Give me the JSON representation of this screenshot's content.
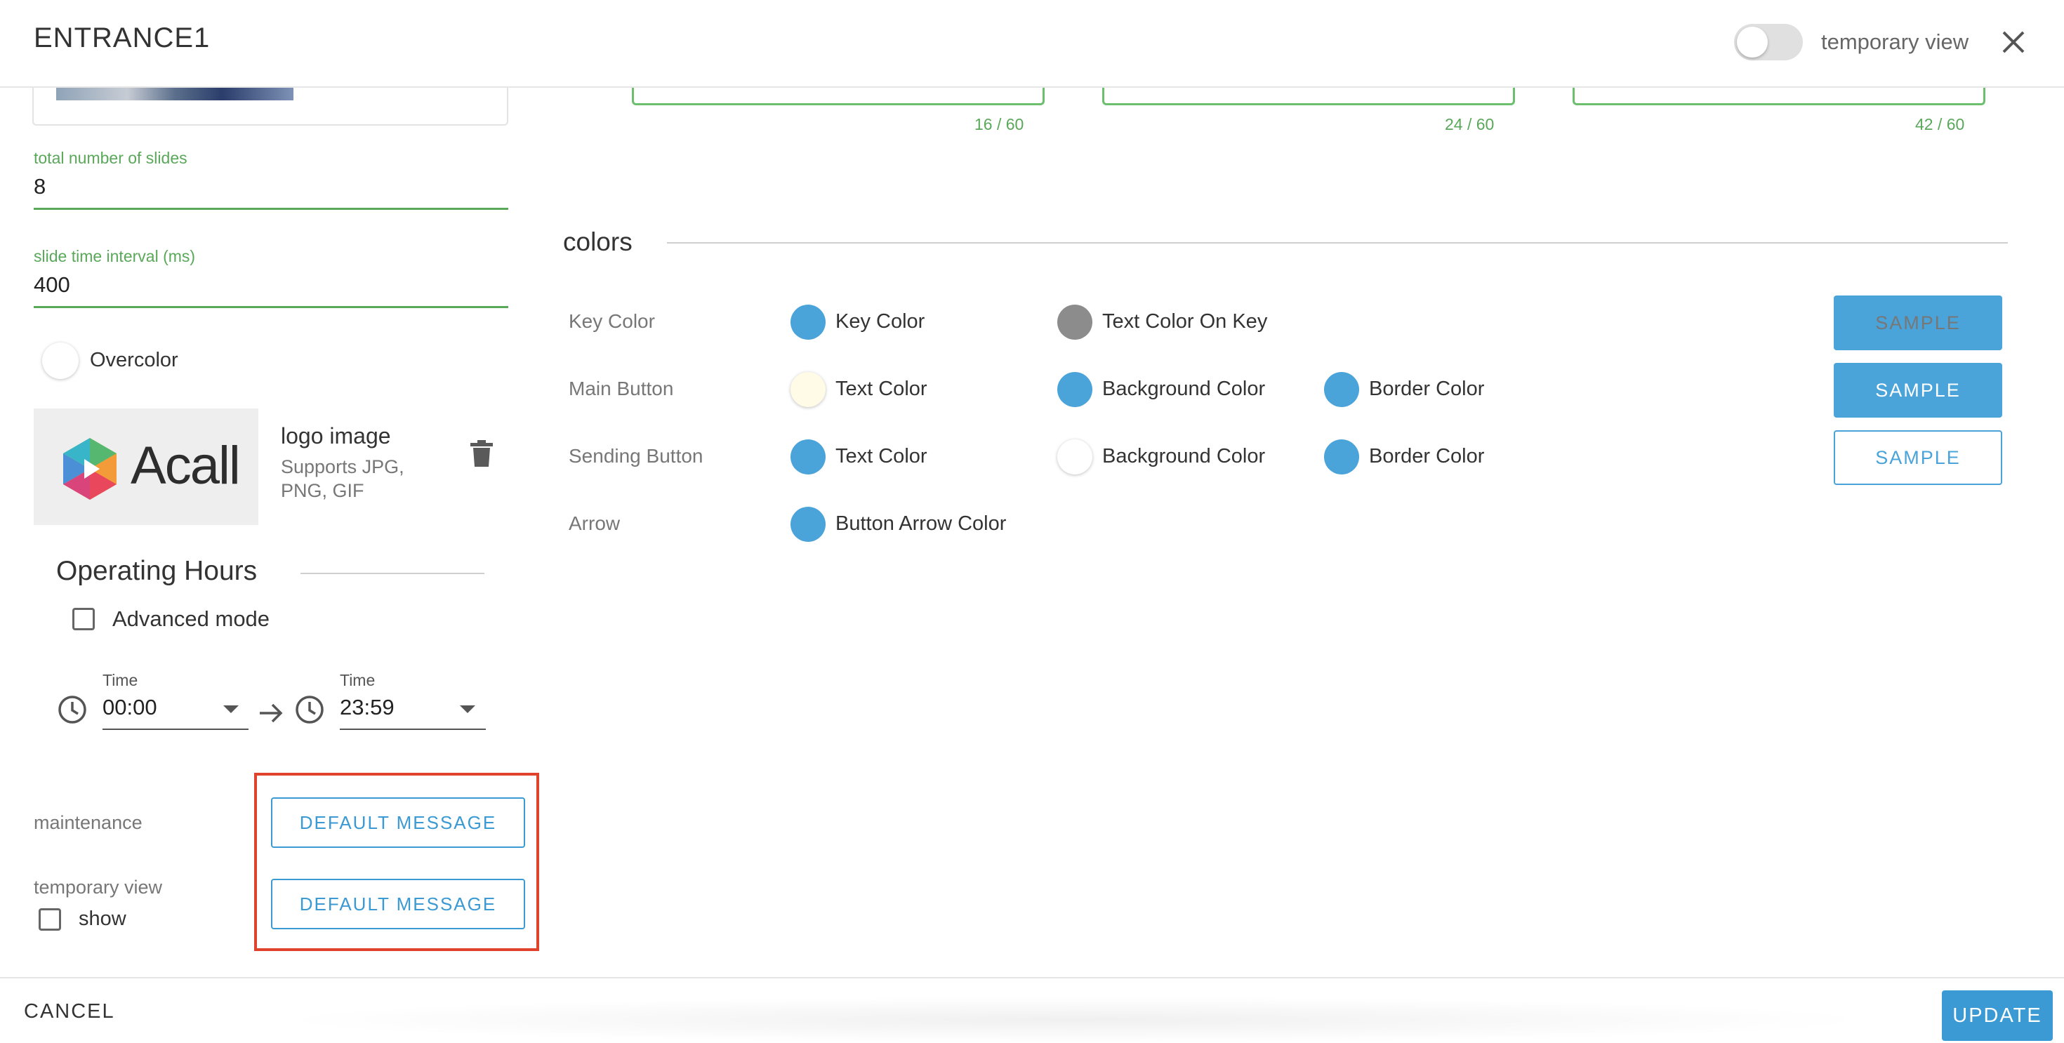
{
  "header": {
    "title": "ENTRANCE1",
    "toggle_label": "temporary view"
  },
  "left": {
    "slides": {
      "label": "total number of slides",
      "value": "8"
    },
    "interval": {
      "label": "slide time interval (ms)",
      "value": "400"
    },
    "overcolor_label": "Overcolor",
    "logo": {
      "image_text": "Acall",
      "title": "logo image",
      "hint_line1": "Supports JPG,",
      "hint_line2": "PNG, GIF"
    },
    "operating_hours": {
      "title": "Operating Hours",
      "advanced_label": "Advanced mode",
      "from": {
        "label": "Time",
        "value": "00:00"
      },
      "to": {
        "label": "Time",
        "value": "23:59"
      }
    },
    "maintenance": {
      "label": "maintenance",
      "button": "DEFAULT MESSAGE"
    },
    "temporary_view": {
      "label": "temporary view",
      "show_label": "show",
      "button": "DEFAULT MESSAGE"
    }
  },
  "right": {
    "counters": [
      "16 / 60",
      "24 / 60",
      "42 / 60"
    ],
    "colors_title": "colors",
    "rows": [
      {
        "label": "Key Color",
        "swatches": [
          {
            "label": "Key Color",
            "color": "#4aa3d9"
          },
          {
            "label": "Text Color On Key",
            "color": "#8c8c8c"
          }
        ],
        "sample": "SAMPLE"
      },
      {
        "label": "Main Button",
        "swatches": [
          {
            "label": "Text Color",
            "color": "#fffbe6"
          },
          {
            "label": "Background Color",
            "color": "#4aa3d9"
          },
          {
            "label": "Border Color",
            "color": "#4aa3d9"
          }
        ],
        "sample": "SAMPLE"
      },
      {
        "label": "Sending Button",
        "swatches": [
          {
            "label": "Text Color",
            "color": "#4aa3d9"
          },
          {
            "label": "Background Color",
            "color": "#ffffff"
          },
          {
            "label": "Border Color",
            "color": "#4aa3d9"
          }
        ],
        "sample": "SAMPLE"
      },
      {
        "label": "Arrow",
        "swatches": [
          {
            "label": "Button Arrow Color",
            "color": "#4aa3d9"
          }
        ]
      }
    ]
  },
  "footer": {
    "cancel": "CANCEL",
    "update": "UPDATE"
  },
  "colors": {
    "accent": "#3b9ad3",
    "success": "#5aa85a",
    "highlight": "#e0432c"
  }
}
